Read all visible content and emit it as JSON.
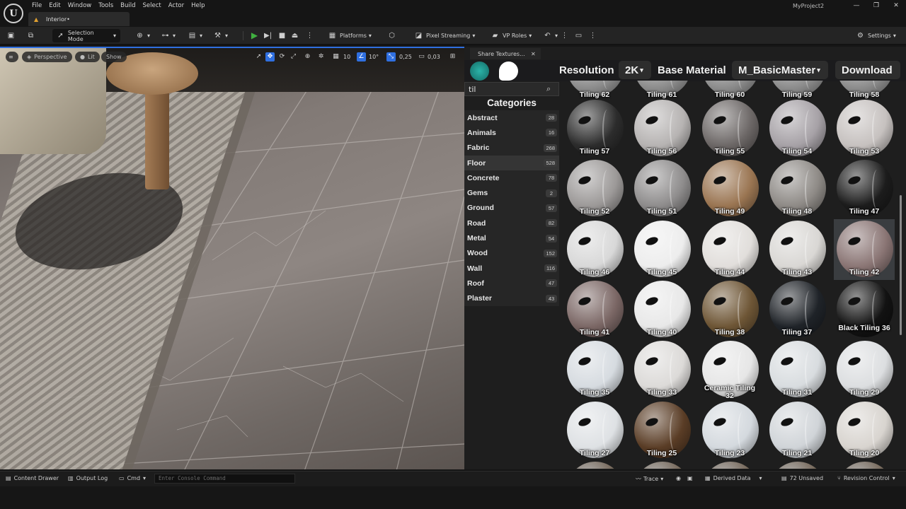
{
  "menu": [
    "File",
    "Edit",
    "Window",
    "Tools",
    "Build",
    "Select",
    "Actor",
    "Help"
  ],
  "project_tab": "Interior•",
  "project_name": "MyProject2",
  "window_controls": [
    "—",
    "❐",
    "✕"
  ],
  "toolbar": {
    "selection_mode": "Selection Mode",
    "platforms": "Platforms",
    "pixel_streaming": "Pixel Streaming",
    "vp_roles": "VP Roles",
    "settings": "Settings"
  },
  "viewport": {
    "perspective": "Perspective",
    "lit": "Lit",
    "show": "Show",
    "grid_snap": "10",
    "rotation_snap": "10°",
    "scale_snap": "0,25",
    "camera_speed": "0,03"
  },
  "panel": {
    "tab_title": "Share Textures...",
    "resolution_label": "Resolution",
    "resolution_value": "2K",
    "base_material_label": "Base Material",
    "base_material_value": "M_BasicMaster",
    "download_label": "Download",
    "search_value": "til",
    "categories_title": "Categories"
  },
  "categories": [
    {
      "name": "Abstract",
      "count": "28"
    },
    {
      "name": "Animals",
      "count": "16"
    },
    {
      "name": "Fabric",
      "count": "268"
    },
    {
      "name": "Floor",
      "count": "528"
    },
    {
      "name": "Concrete",
      "count": "78"
    },
    {
      "name": "Gems",
      "count": "2"
    },
    {
      "name": "Ground",
      "count": "57"
    },
    {
      "name": "Road",
      "count": "82"
    },
    {
      "name": "Metal",
      "count": "54"
    },
    {
      "name": "Wood",
      "count": "152"
    },
    {
      "name": "Wall",
      "count": "116"
    },
    {
      "name": "Roof",
      "count": "47"
    },
    {
      "name": "Plaster",
      "count": "43"
    }
  ],
  "selected_category": "Floor",
  "top_row": [
    "Tiling 62",
    "Tiling 61",
    "Tiling 60",
    "Tiling 59",
    "Tiling 58"
  ],
  "materials": [
    {
      "label": "Tiling 57",
      "color": "#2c2c2c"
    },
    {
      "label": "Tiling 56",
      "color": "#b6b3b2"
    },
    {
      "label": "Tiling 55",
      "color": "#6c6766"
    },
    {
      "label": "Tiling 54",
      "color": "#a6a1a6"
    },
    {
      "label": "Tiling 53",
      "color": "#c6c1bf"
    },
    {
      "label": "Tiling 52",
      "color": "#9c9998"
    },
    {
      "label": "Tiling 51",
      "color": "#8e8c8c"
    },
    {
      "label": "Tiling 49",
      "color": "#9a7552"
    },
    {
      "label": "Tiling 48",
      "color": "#8e8a86"
    },
    {
      "label": "Tiling 47",
      "color": "#1c1c1c"
    },
    {
      "label": "Tiling 46",
      "color": "#d8d8d8"
    },
    {
      "label": "Tiling 45",
      "color": "#ededed"
    },
    {
      "label": "Tiling 44",
      "color": "#e1dedb"
    },
    {
      "label": "Tiling 43",
      "color": "#d9d7d4"
    },
    {
      "label": "Tiling 42",
      "color": "#8a7574"
    },
    {
      "label": "Tiling 41",
      "color": "#7b6765"
    },
    {
      "label": "Tiling 40",
      "color": "#e8e8e8"
    },
    {
      "label": "Tiling 38",
      "color": "#6e5636"
    },
    {
      "label": "Tiling 37",
      "color": "#1f2328"
    },
    {
      "label": "Black Tiling 36",
      "color": "#121212"
    },
    {
      "label": "Tiling 35",
      "color": "#d6dbe0"
    },
    {
      "label": "Tiling 33",
      "color": "#dcdad8"
    },
    {
      "label": "Ceramic Tiling 32",
      "color": "#e6e6e6"
    },
    {
      "label": "Tiling 31",
      "color": "#d8dcdf"
    },
    {
      "label": "Tiling 29",
      "color": "#dcdee0"
    },
    {
      "label": "Tiling 27",
      "color": "#dee1e4"
    },
    {
      "label": "Tiling 25",
      "color": "#5a3d26"
    },
    {
      "label": "Tiling 23",
      "color": "#d4d9de"
    },
    {
      "label": "Tiling 21",
      "color": "#d0d4d8"
    },
    {
      "label": "Tiling 20",
      "color": "#d8d4cf"
    }
  ],
  "selected_material": "Tiling 42",
  "statusbar": {
    "content_drawer": "Content Drawer",
    "output_log": "Output Log",
    "cmd": "Cmd",
    "console_placeholder": "Enter Console Command",
    "trace": "Trace",
    "derived_data": "Derived Data",
    "unsaved": "72 Unsaved",
    "revision_control": "Revision Control"
  },
  "colors": {
    "accent": "#2f6fe0",
    "play": "#40b040"
  }
}
